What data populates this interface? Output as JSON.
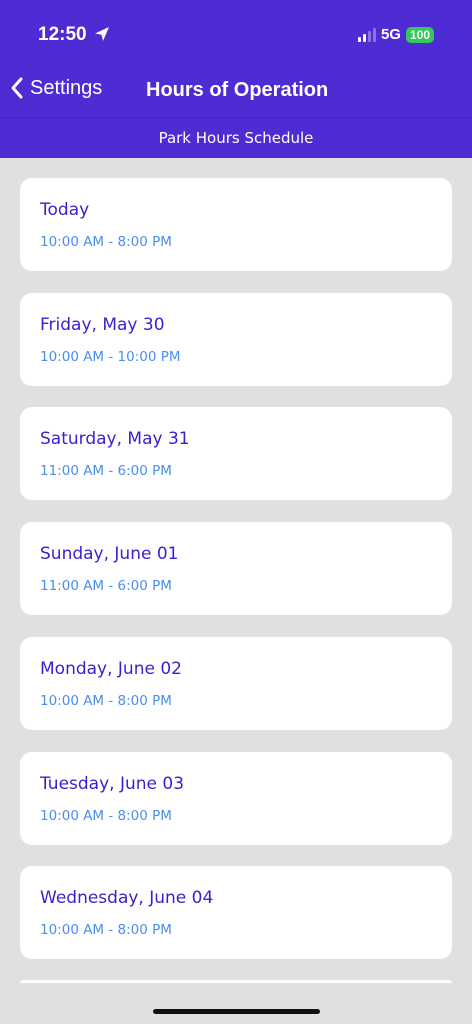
{
  "status": {
    "time": "12:50",
    "network": "5G",
    "battery": "100"
  },
  "nav": {
    "back_label": "Settings",
    "title": "Hours of Operation"
  },
  "subtitle": "Park Hours Schedule",
  "days": [
    {
      "day": "Today",
      "hours": "10:00 AM - 8:00 PM"
    },
    {
      "day": "Friday, May 30",
      "hours": "10:00 AM - 10:00 PM"
    },
    {
      "day": "Saturday, May 31",
      "hours": "11:00 AM - 6:00 PM"
    },
    {
      "day": "Sunday, June 01",
      "hours": "11:00 AM - 6:00 PM"
    },
    {
      "day": "Monday, June 02",
      "hours": "10:00 AM - 8:00 PM"
    },
    {
      "day": "Tuesday, June 03",
      "hours": "10:00 AM - 8:00 PM"
    },
    {
      "day": "Wednesday, June 04",
      "hours": "10:00 AM - 8:00 PM"
    }
  ],
  "colors": {
    "header": "#4f2bd3",
    "day_text": "#3b1fcf",
    "hours_text": "#4a8ef0"
  }
}
